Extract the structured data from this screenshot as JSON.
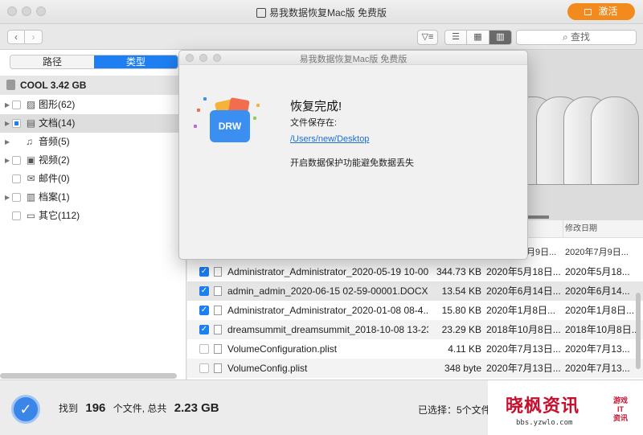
{
  "window": {
    "title": "易我数据恢复Mac版 免费版",
    "activate_label": "激活"
  },
  "toolbar": {
    "back": "‹",
    "forward": "›",
    "filter_icon": "filter-icon",
    "search_placeholder": "查找"
  },
  "sidebar": {
    "tabs": [
      {
        "label": "路径",
        "active": false
      },
      {
        "label": "类型",
        "active": true
      }
    ],
    "drive": "COOL 3.42 GB",
    "items": [
      {
        "label": "图形(62)",
        "icon": "image-file-icon",
        "expandable": true
      },
      {
        "label": "文档(14)",
        "icon": "document-icon",
        "expandable": true,
        "selected": true,
        "partial": true
      },
      {
        "label": "音频(5)",
        "icon": "music-note-icon",
        "expandable": true
      },
      {
        "label": "视频(2)",
        "icon": "film-icon",
        "expandable": true
      },
      {
        "label": "邮件(0)",
        "icon": "mail-icon",
        "expandable": false
      },
      {
        "label": "档案(1)",
        "icon": "archive-icon",
        "expandable": true
      },
      {
        "label": "其它(112)",
        "icon": "folder-icon",
        "expandable": false
      }
    ]
  },
  "table": {
    "columns": {
      "modified": "修改日期"
    },
    "partial_row": {
      "created": "月9日...",
      "modified": "2020年7月9日..."
    },
    "rows": [
      {
        "checked": true,
        "name": "Administrator_Administrator_2020-05-19 10-00...",
        "size": "344.73 KB",
        "created": "2020年5月18日...",
        "modified": "2020年5月18..."
      },
      {
        "checked": true,
        "name": "admin_admin_2020-06-15 02-59-00001.DOCX",
        "size": "13.54 KB",
        "created": "2020年6月14日...",
        "modified": "2020年6月14..."
      },
      {
        "checked": true,
        "name": "Administrator_Administrator_2020-01-08 08-4...",
        "size": "15.80 KB",
        "created": "2020年1月8日...",
        "modified": "2020年1月8日..."
      },
      {
        "checked": true,
        "name": "dreamsummit_dreamsummit_2018-10-08 13-23...",
        "size": "23.29 KB",
        "created": "2018年10月8日...",
        "modified": "2018年10月8日..."
      },
      {
        "checked": false,
        "name": "VolumeConfiguration.plist",
        "size": "4.11 KB",
        "created": "2020年7月13日...",
        "modified": "2020年7月13..."
      },
      {
        "checked": false,
        "name": "VolumeConfig.plist",
        "size": "348 byte",
        "created": "2020年7月13日...",
        "modified": "2020年7月13..."
      }
    ]
  },
  "dialog": {
    "title": "易我数据恢复Mac版 免费版",
    "logo_text": "DRW",
    "heading": "恢复完成!",
    "saved_to_label": "文件保存在:",
    "path": "/Users/new/Desktop",
    "note": "开启数据保护功能避免数据丢失"
  },
  "status": {
    "found_prefix": "找到",
    "file_count": "196",
    "files_mid": "个文件, 总共",
    "total_size": "2.23 GB",
    "selected": "已选择：5个文件"
  },
  "watermark": {
    "main": "晓枫资讯",
    "url": "bbs.yzwlo.com",
    "side": [
      "游戏",
      "IT",
      "资讯"
    ]
  },
  "colors": {
    "accent": "#1e7ff3",
    "activate": "#f28a1e",
    "watermark": "#c8102e"
  }
}
